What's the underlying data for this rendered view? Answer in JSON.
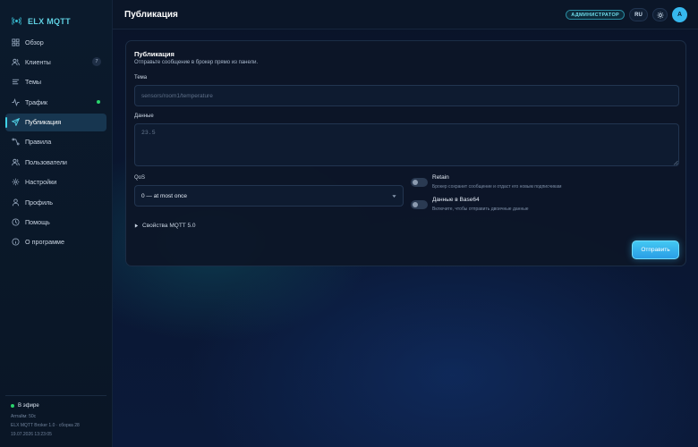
{
  "app": {
    "name": "ELX MQTT"
  },
  "sidebar": {
    "items": [
      {
        "label": "Обзор",
        "icon": "grid-icon"
      },
      {
        "label": "Клиенты",
        "icon": "users-icon",
        "badge": "7"
      },
      {
        "label": "Темы",
        "icon": "list-icon"
      },
      {
        "label": "Трафик",
        "icon": "activity-icon",
        "live": true
      },
      {
        "label": "Публикация",
        "icon": "send-icon",
        "active": true
      },
      {
        "label": "Правила",
        "icon": "rules-icon"
      },
      {
        "label": "Пользователи",
        "icon": "user-group-icon"
      },
      {
        "label": "Настройки",
        "icon": "gear-icon"
      },
      {
        "label": "Профиль",
        "icon": "user-icon"
      },
      {
        "label": "Помощь",
        "icon": "help-icon"
      },
      {
        "label": "О программе",
        "icon": "info-icon"
      }
    ],
    "footer": {
      "status": "В эфире",
      "uptime": "Аптайм: 50с",
      "version": "ELX MQTT Broker 1.0 · сборка 28",
      "timestamp": "19.07.2026 13:23:05"
    }
  },
  "header": {
    "title": "Публикация",
    "role": "АДМИНИСТРАТОР",
    "lang": "RU",
    "avatar": "A"
  },
  "form": {
    "title": "Публикация",
    "subtitle": "Отправьте сообщение в брокер прямо из панели.",
    "topic_label": "Тема",
    "topic_placeholder": "sensors/room1/temperature",
    "payload_label": "Данные",
    "payload_placeholder": "23.5",
    "qos_label": "QoS",
    "qos_value": "0 — at most once",
    "retain_title": "Retain",
    "retain_desc": "Брокер сохранит сообщение и отдаст его новым подписчикам",
    "base64_title": "Данные в Base64",
    "base64_desc": "Включите, чтобы отправить двоичные данные",
    "mqtt5_label": "Свойства MQTT 5.0",
    "send_label": "Отправить"
  },
  "colors": {
    "accent": "#3fd3e8",
    "live": "#2ad36b",
    "button": "#43c7f2"
  }
}
